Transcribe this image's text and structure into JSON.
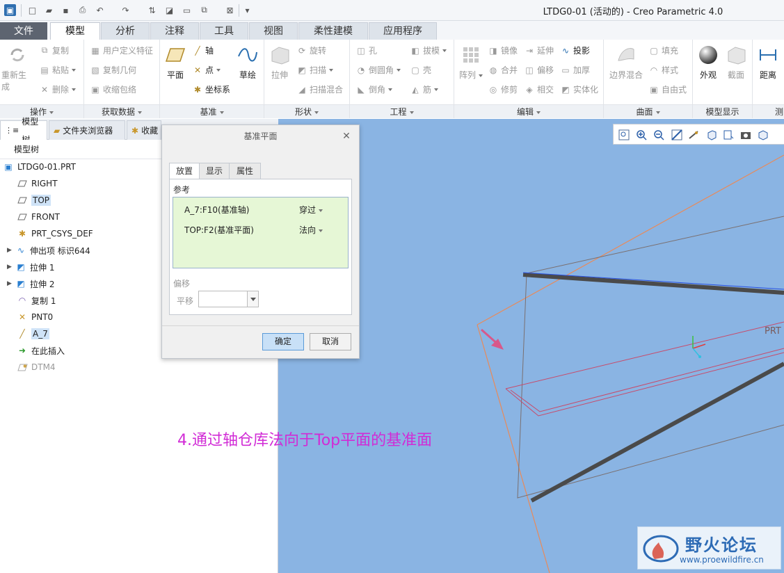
{
  "window": {
    "title": "LTDG0-01 (活动的) - Creo Parametric 4.0"
  },
  "ribbon_tabs": [
    {
      "label": "文件"
    },
    {
      "label": "模型"
    },
    {
      "label": "分析"
    },
    {
      "label": "注释"
    },
    {
      "label": "工具"
    },
    {
      "label": "视图"
    },
    {
      "label": "柔性建模"
    },
    {
      "label": "应用程序"
    }
  ],
  "ribbon": {
    "ops": {
      "title": "操作",
      "regen": "重新生成",
      "copy": "复制",
      "paste": "粘贴",
      "delete": "删除"
    },
    "getdata": {
      "title": "获取数据",
      "udf": "用户定义特征",
      "copygeom": "复制几何",
      "shrink": "收缩包络"
    },
    "datum": {
      "title": "基准",
      "plane": "平面",
      "axis": "轴",
      "point": "点",
      "csys": "坐标系",
      "sketch": "草绘"
    },
    "shape": {
      "title": "形状",
      "extrude": "拉伸",
      "revolve": "旋转",
      "sweep": "扫描",
      "sweepblend": "扫描混合"
    },
    "eng": {
      "title": "工程",
      "hole": "孔",
      "round": "倒圆角",
      "chamfer": "倒角",
      "draft": "拔模",
      "shell": "壳",
      "rib": "筋"
    },
    "edit": {
      "title": "编辑",
      "pattern": "阵列",
      "mirror": "镜像",
      "merge": "合并",
      "trim": "修剪",
      "extend": "延伸",
      "offset": "偏移",
      "intersect": "相交",
      "project": "投影",
      "thicken": "加厚",
      "solidify": "实体化"
    },
    "surface": {
      "title": "曲面",
      "boundary": "边界混合",
      "fill": "填充",
      "style": "样式",
      "freestyle": "自由式"
    },
    "display": {
      "title": "模型显示",
      "appearance": "外观",
      "section": "截面"
    },
    "measure": {
      "title": "测",
      "distance": "距离"
    }
  },
  "left_tabs": [
    {
      "label": "模型树"
    },
    {
      "label": "文件夹浏览器"
    },
    {
      "label": "收藏"
    }
  ],
  "tree_header": "模型树",
  "tree": [
    {
      "label": "LTDG0-01.PRT"
    },
    {
      "label": "RIGHT"
    },
    {
      "label": "TOP"
    },
    {
      "label": "FRONT"
    },
    {
      "label": "PRT_CSYS_DEF"
    },
    {
      "label": "伸出项 标识644"
    },
    {
      "label": "拉伸 1"
    },
    {
      "label": "拉伸 2"
    },
    {
      "label": "复制 1"
    },
    {
      "label": "PNT0"
    },
    {
      "label": "A_7"
    },
    {
      "label": "在此插入"
    },
    {
      "label": "DTM4"
    }
  ],
  "dialog": {
    "title": "基准平面",
    "tabs": [
      {
        "label": "放置"
      },
      {
        "label": "显示"
      },
      {
        "label": "属性"
      }
    ],
    "ref_label": "参考",
    "refs": [
      {
        "name": "A_7:F10(基准轴)",
        "constraint": "穿过"
      },
      {
        "name": "TOP:F2(基准平面)",
        "constraint": "法向"
      }
    ],
    "offset_label": "偏移",
    "translate_label": "平移",
    "ok": "确定",
    "cancel": "取消"
  },
  "viewport": {
    "prt_label": "PRT"
  },
  "annotation": "4.通过轴仓库法向于Top平面的基准面",
  "watermark": {
    "title": "野火论坛",
    "url": "www.proewildfire.cn"
  },
  "colors": {
    "accent": "#d12bd6",
    "viewport_bg": "#8ab4e3",
    "ref_box": "#e6f7d6"
  }
}
